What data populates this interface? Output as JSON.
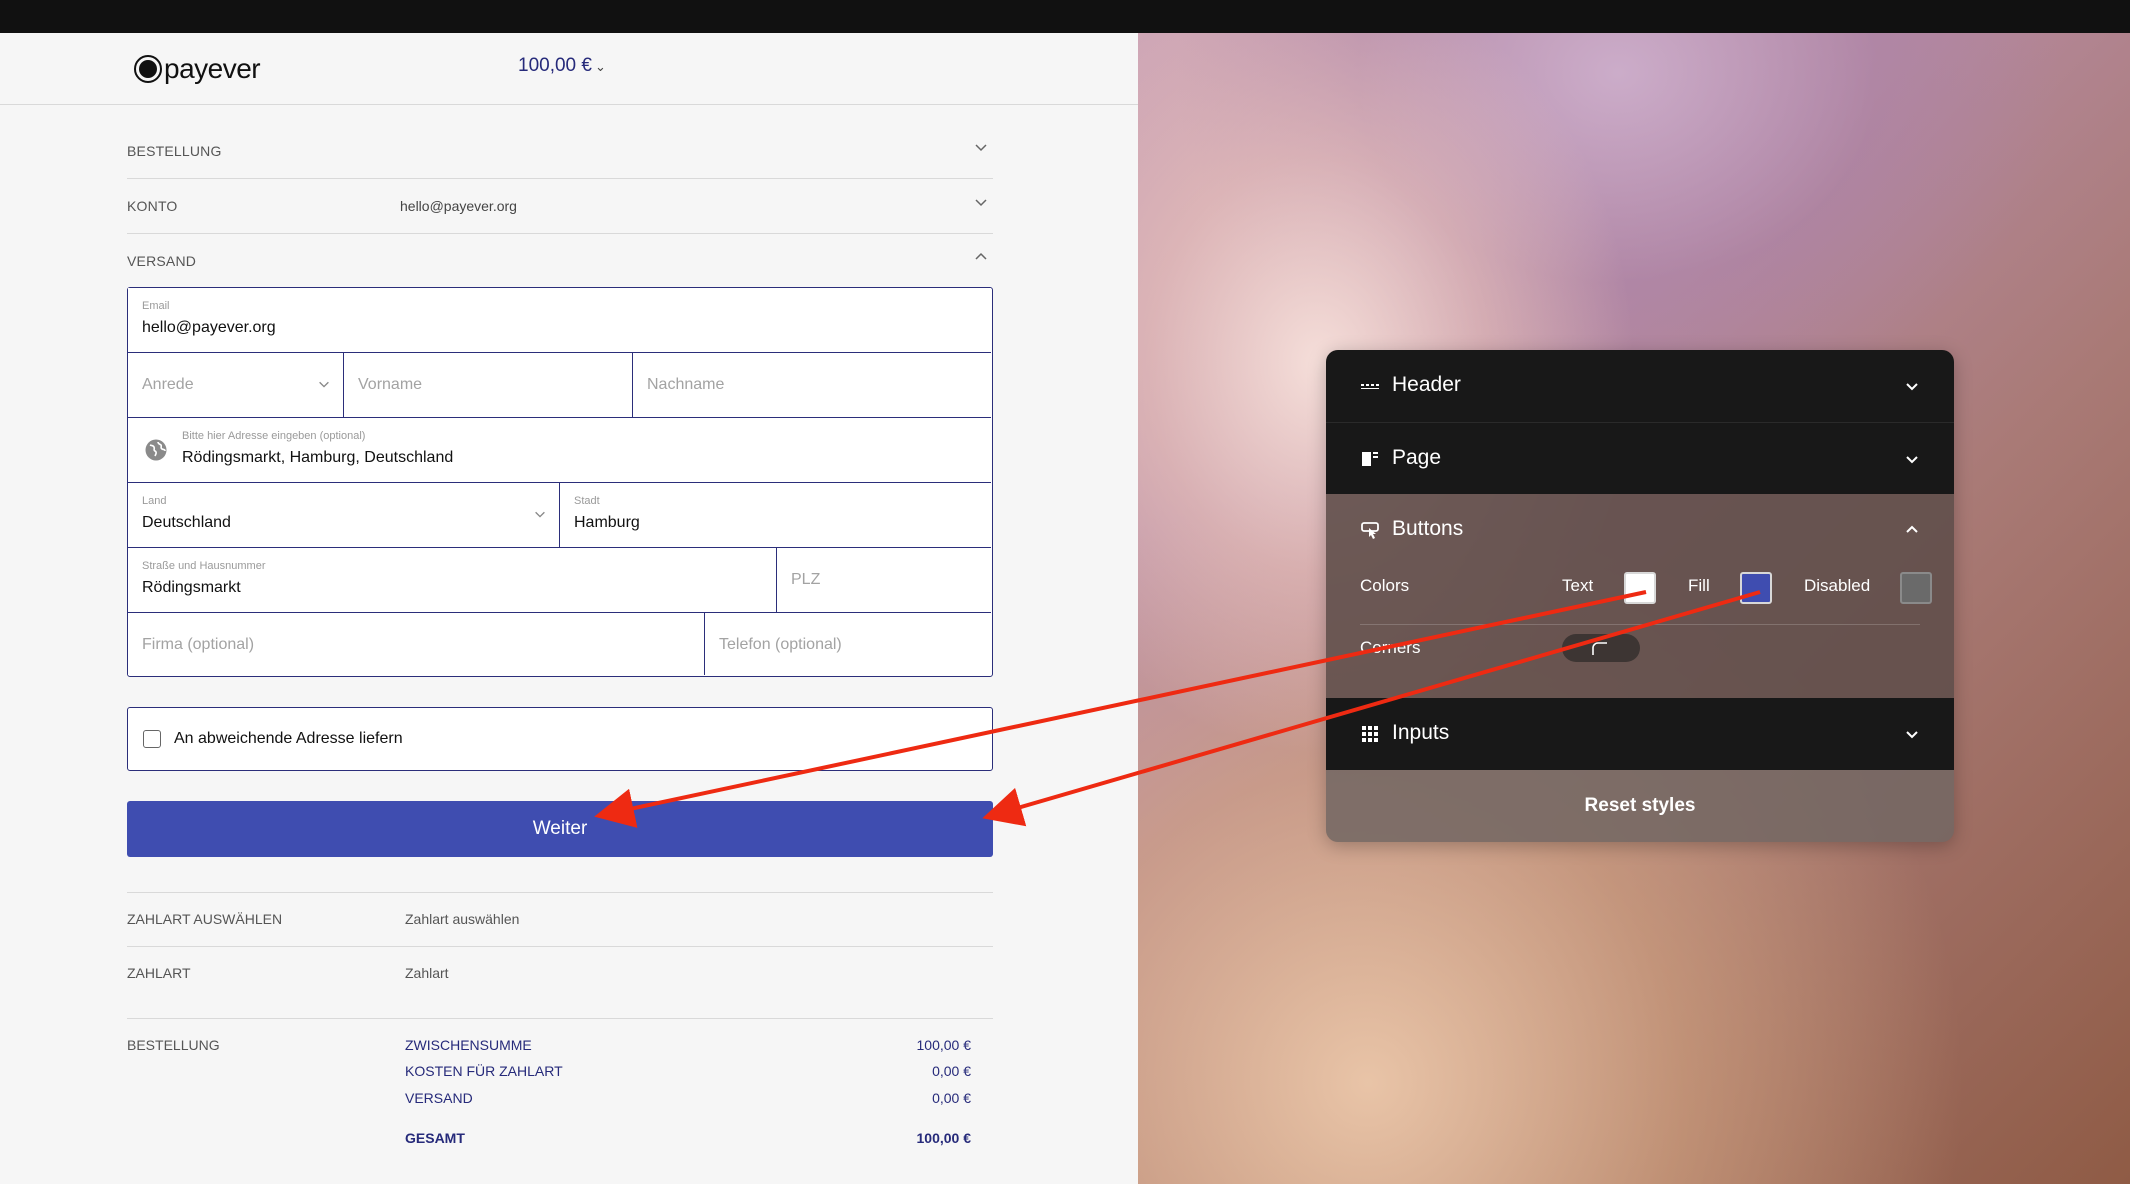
{
  "header": {
    "logo_text": "payever",
    "amount": "100,00 €"
  },
  "sections": {
    "bestellung": "BESTELLUNG",
    "konto": "KONTO",
    "konto_value": "hello@payever.org",
    "versand": "VERSAND"
  },
  "form": {
    "email_label": "Email",
    "email_value": "hello@payever.org",
    "anrede_placeholder": "Anrede",
    "vorname_placeholder": "Vorname",
    "nachname_placeholder": "Nachname",
    "address_label": "Bitte hier Adresse eingeben (optional)",
    "address_value": "Rödingsmarkt, Hamburg, Deutschland",
    "land_label": "Land",
    "land_value": "Deutschland",
    "stadt_label": "Stadt",
    "stadt_value": "Hamburg",
    "strasse_label": "Straße und Hausnummer",
    "strasse_value": "Rödingsmarkt",
    "plz_placeholder": "PLZ",
    "firma_placeholder": "Firma (optional)",
    "telefon_placeholder": "Telefon (optional)",
    "alt_address_label": "An abweichende Adresse liefern",
    "submit_label": "Weiter"
  },
  "payment": {
    "zahlart_auswaehlen_label": "ZAHLART AUSWÄHLEN",
    "zahlart_auswaehlen_value": "Zahlart auswählen",
    "zahlart_label": "ZAHLART",
    "zahlart_value": "Zahlart"
  },
  "summary": {
    "label": "BESTELLUNG",
    "lines": [
      {
        "key": "ZWISCHENSUMME",
        "amount": "100,00 €"
      },
      {
        "key": "KOSTEN FÜR ZAHLART",
        "amount": "0,00 €"
      },
      {
        "key": "VERSAND",
        "amount": "0,00 €"
      }
    ],
    "total_key": "GESAMT",
    "total_amount": "100,00 €"
  },
  "panel": {
    "header_label": "Header",
    "page_label": "Page",
    "buttons_label": "Buttons",
    "colors_label": "Colors",
    "text_label": "Text",
    "fill_label": "Fill",
    "disabled_label": "Disabled",
    "corners_label": "Corners",
    "inputs_label": "Inputs",
    "reset_label": "Reset styles",
    "colors": {
      "text": "#ffffff",
      "fill": "#3f4db0",
      "disabled": "#6a6a6a"
    }
  },
  "annotation": {
    "arrow_color": "#ee2a12"
  }
}
